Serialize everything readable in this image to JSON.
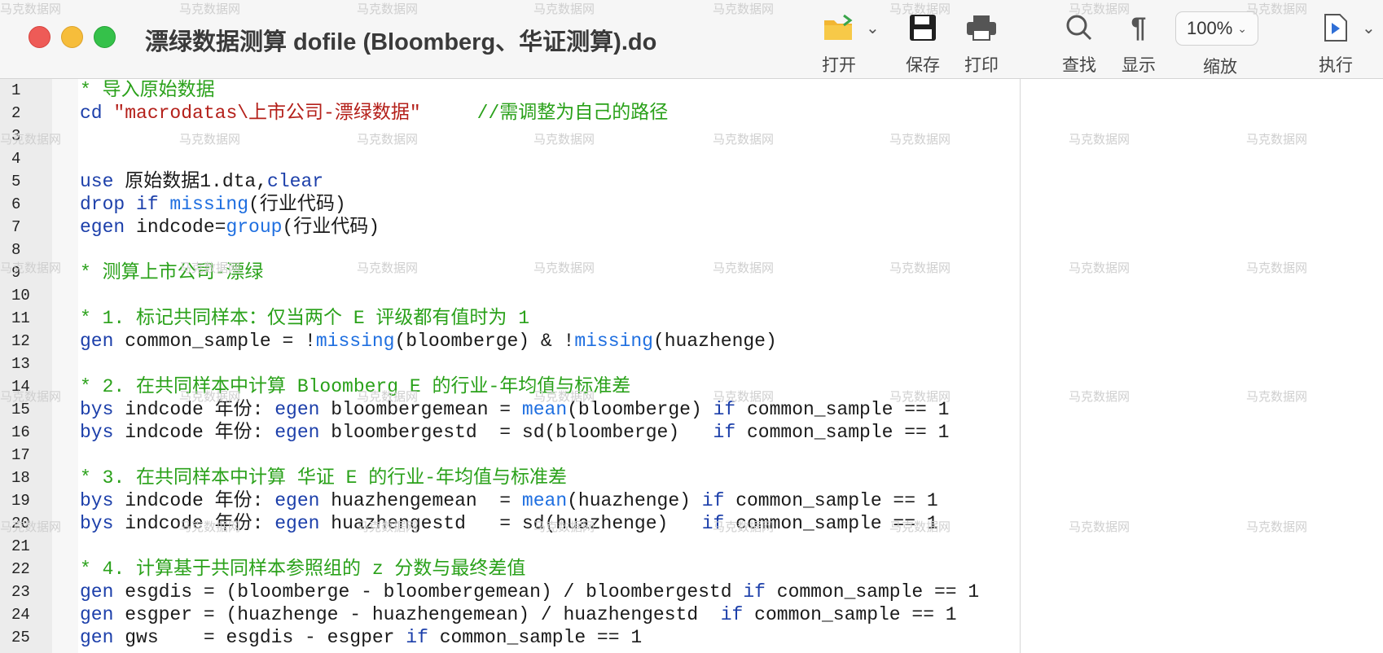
{
  "window": {
    "title": "漂绿数据测算 dofile (Bloomberg、华证测算).do"
  },
  "toolbar": {
    "open_label": "打开",
    "save_label": "保存",
    "print_label": "打印",
    "find_label": "查找",
    "show_label": "显示",
    "zoom_label": "缩放",
    "zoom_value": "100%",
    "run_label": "执行"
  },
  "watermark": "马克数据网",
  "editor": {
    "lines": [
      {
        "n": "1",
        "segs": [
          [
            "c",
            "* 导入原始数据"
          ]
        ]
      },
      {
        "n": "2",
        "segs": [
          [
            "k",
            "cd "
          ],
          [
            "s",
            "\"macrodatas\\上市公司-漂绿数据\""
          ],
          [
            "p",
            "     "
          ],
          [
            "c",
            "//需调整为自己的路径"
          ]
        ]
      },
      {
        "n": "3",
        "segs": []
      },
      {
        "n": "4",
        "segs": []
      },
      {
        "n": "5",
        "segs": [
          [
            "k",
            "use "
          ],
          [
            "p",
            "原始数据1.dta,"
          ],
          [
            "k",
            "clear"
          ]
        ]
      },
      {
        "n": "6",
        "segs": [
          [
            "k",
            "drop if "
          ],
          [
            "f",
            "missing"
          ],
          [
            "p",
            "(行业代码)"
          ]
        ]
      },
      {
        "n": "7",
        "segs": [
          [
            "k",
            "egen "
          ],
          [
            "p",
            "indcode="
          ],
          [
            "f",
            "group"
          ],
          [
            "p",
            "(行业代码)"
          ]
        ]
      },
      {
        "n": "8",
        "segs": []
      },
      {
        "n": "9",
        "segs": [
          [
            "c",
            "* 测算上市公司-漂绿"
          ]
        ]
      },
      {
        "n": "10",
        "segs": []
      },
      {
        "n": "11",
        "segs": [
          [
            "c",
            "* 1. 标记共同样本：仅当两个 E 评级都有值时为 1"
          ]
        ]
      },
      {
        "n": "12",
        "segs": [
          [
            "k",
            "gen "
          ],
          [
            "p",
            "common_sample = !"
          ],
          [
            "f",
            "missing"
          ],
          [
            "p",
            "(bloomberge) & !"
          ],
          [
            "f",
            "missing"
          ],
          [
            "p",
            "(huazhenge)"
          ]
        ]
      },
      {
        "n": "13",
        "segs": []
      },
      {
        "n": "14",
        "segs": [
          [
            "c",
            "* 2. 在共同样本中计算 Bloomberg E 的行业-年均值与标准差"
          ]
        ]
      },
      {
        "n": "15",
        "segs": [
          [
            "k",
            "bys "
          ],
          [
            "p",
            "indcode 年份: "
          ],
          [
            "k",
            "egen "
          ],
          [
            "p",
            "bloombergemean = "
          ],
          [
            "f",
            "mean"
          ],
          [
            "p",
            "(bloomberge) "
          ],
          [
            "k",
            "if "
          ],
          [
            "p",
            "common_sample == 1"
          ]
        ]
      },
      {
        "n": "16",
        "segs": [
          [
            "k",
            "bys "
          ],
          [
            "p",
            "indcode 年份: "
          ],
          [
            "k",
            "egen "
          ],
          [
            "p",
            "bloombergestd  = sd(bloomberge)   "
          ],
          [
            "k",
            "if "
          ],
          [
            "p",
            "common_sample == 1"
          ]
        ]
      },
      {
        "n": "17",
        "segs": []
      },
      {
        "n": "18",
        "segs": [
          [
            "c",
            "* 3. 在共同样本中计算 华证 E 的行业-年均值与标准差"
          ]
        ]
      },
      {
        "n": "19",
        "segs": [
          [
            "k",
            "bys "
          ],
          [
            "p",
            "indcode 年份: "
          ],
          [
            "k",
            "egen "
          ],
          [
            "p",
            "huazhengemean  = "
          ],
          [
            "f",
            "mean"
          ],
          [
            "p",
            "(huazhenge) "
          ],
          [
            "k",
            "if "
          ],
          [
            "p",
            "common_sample == 1"
          ]
        ]
      },
      {
        "n": "20",
        "segs": [
          [
            "k",
            "bys "
          ],
          [
            "p",
            "indcode 年份: "
          ],
          [
            "k",
            "egen "
          ],
          [
            "p",
            "huazhengestd   = sd(huazhenge)   "
          ],
          [
            "k",
            "if "
          ],
          [
            "p",
            "common_sample == 1"
          ]
        ]
      },
      {
        "n": "21",
        "segs": []
      },
      {
        "n": "22",
        "segs": [
          [
            "c",
            "* 4. 计算基于共同样本参照组的 z 分数与最终差值"
          ]
        ]
      },
      {
        "n": "23",
        "segs": [
          [
            "k",
            "gen "
          ],
          [
            "p",
            "esgdis = (bloomberge - bloombergemean) / bloombergestd "
          ],
          [
            "k",
            "if "
          ],
          [
            "p",
            "common_sample == 1"
          ]
        ]
      },
      {
        "n": "24",
        "segs": [
          [
            "k",
            "gen "
          ],
          [
            "p",
            "esgper = (huazhenge - huazhengemean) / huazhengestd  "
          ],
          [
            "k",
            "if "
          ],
          [
            "p",
            "common_sample == 1"
          ]
        ]
      },
      {
        "n": "25",
        "segs": [
          [
            "k",
            "gen "
          ],
          [
            "p",
            "gws    = esgdis - esgper "
          ],
          [
            "k",
            "if "
          ],
          [
            "p",
            "common_sample == 1"
          ]
        ]
      }
    ]
  }
}
